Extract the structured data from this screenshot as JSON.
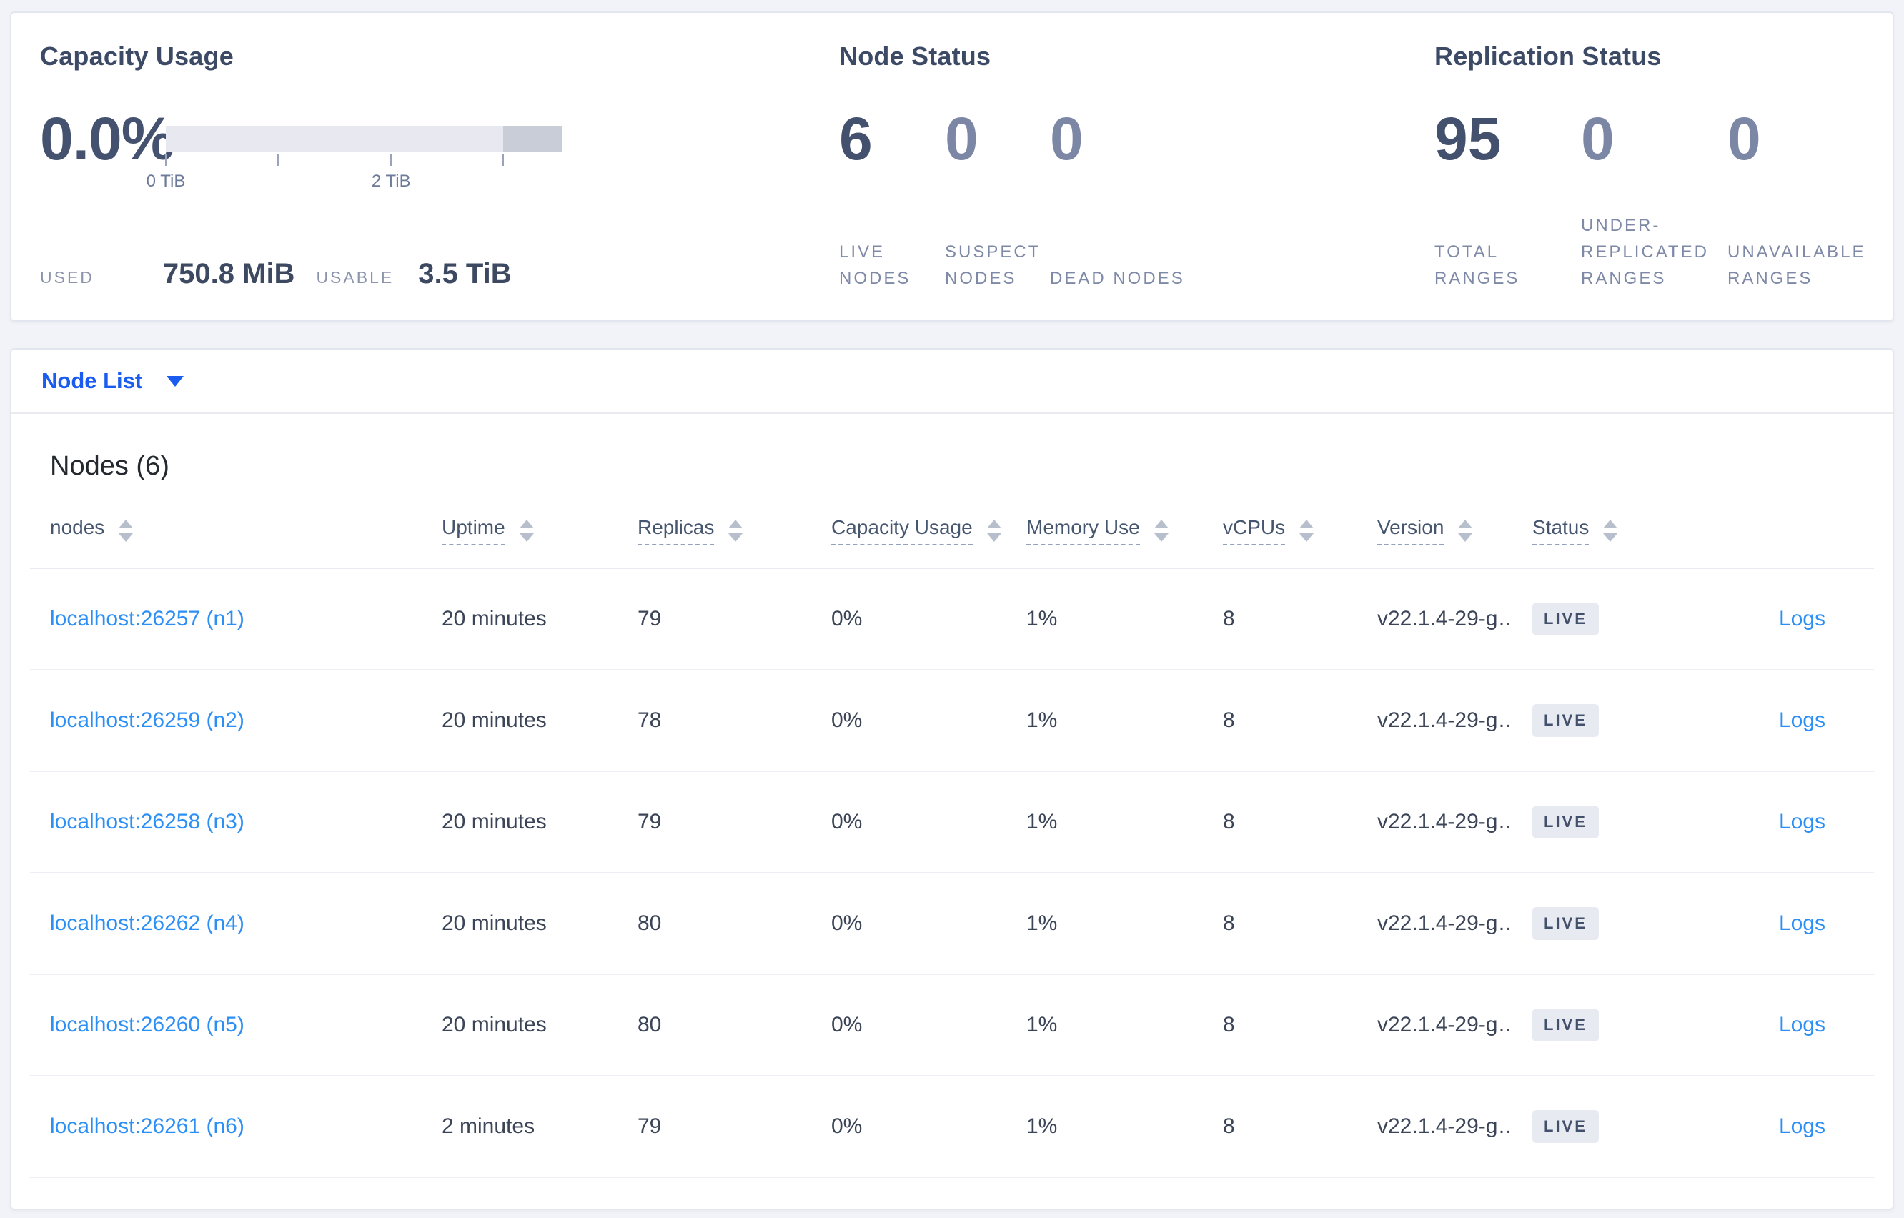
{
  "colors": {
    "page_background": "#f1f3f8",
    "accent_blue": "#1a5cf0",
    "link_blue": "#2b8ff5",
    "dark_slate": "#43516e",
    "muted_label": "#7e89a7",
    "badge_background": "#e7eaf1",
    "bar_light": "#e8e9f0",
    "bar_dark": "#c9cdd8"
  },
  "capacity_usage": {
    "title": "Capacity Usage",
    "percent": "0.0%",
    "used_label": "USED",
    "used_value": "750.8 MiB",
    "usable_label": "USABLE",
    "usable_value": "3.5 TiB",
    "bar": {
      "dark_segment_start_frac": "85.1%",
      "ticks": [
        {
          "left": "0%",
          "label": "0 TiB"
        },
        {
          "left": "28.3%",
          "label": ""
        },
        {
          "left": "56.8%",
          "label": "2 TiB"
        },
        {
          "left": "85.1%",
          "label": ""
        }
      ]
    }
  },
  "node_status": {
    "title": "Node Status",
    "stats": [
      {
        "value": "6",
        "label": "LIVE NODES",
        "primary": true
      },
      {
        "value": "0",
        "label": "SUSPECT NODES"
      },
      {
        "value": "0",
        "label": "DEAD NODES"
      }
    ]
  },
  "replication_status": {
    "title": "Replication Status",
    "stats": [
      {
        "value": "95",
        "label": "TOTAL RANGES",
        "primary": true
      },
      {
        "value": "0",
        "label": "UNDER-REPLICATED RANGES"
      },
      {
        "value": "0",
        "label": "UNAVAILABLE RANGES"
      }
    ]
  },
  "node_list": {
    "dropdown_label": "Node List",
    "section_title": "Nodes (6)",
    "columns": [
      {
        "key": "node",
        "label": "nodes"
      },
      {
        "key": "uptime",
        "label": "Uptime",
        "dashed": true
      },
      {
        "key": "replicas",
        "label": "Replicas",
        "dashed": true
      },
      {
        "key": "capacity",
        "label": "Capacity Usage",
        "dashed": true
      },
      {
        "key": "memory",
        "label": "Memory Use",
        "dashed": true
      },
      {
        "key": "vcpus",
        "label": "vCPUs",
        "dashed": true
      },
      {
        "key": "version",
        "label": "Version",
        "dashed": true
      },
      {
        "key": "status",
        "label": "Status",
        "dashed": true
      },
      {
        "key": "logs",
        "label": "",
        "no_sort": true
      }
    ],
    "rows": [
      {
        "node": "localhost:26257 (n1)",
        "uptime": "20 minutes",
        "replicas": "79",
        "capacity": "0%",
        "memory": "1%",
        "vcpus": "8",
        "version": "v22.1.4-29-g…",
        "status": "LIVE",
        "logs": "Logs"
      },
      {
        "node": "localhost:26259 (n2)",
        "uptime": "20 minutes",
        "replicas": "78",
        "capacity": "0%",
        "memory": "1%",
        "vcpus": "8",
        "version": "v22.1.4-29-g…",
        "status": "LIVE",
        "logs": "Logs"
      },
      {
        "node": "localhost:26258 (n3)",
        "uptime": "20 minutes",
        "replicas": "79",
        "capacity": "0%",
        "memory": "1%",
        "vcpus": "8",
        "version": "v22.1.4-29-g…",
        "status": "LIVE",
        "logs": "Logs"
      },
      {
        "node": "localhost:26262 (n4)",
        "uptime": "20 minutes",
        "replicas": "80",
        "capacity": "0%",
        "memory": "1%",
        "vcpus": "8",
        "version": "v22.1.4-29-g…",
        "status": "LIVE",
        "logs": "Logs"
      },
      {
        "node": "localhost:26260 (n5)",
        "uptime": "20 minutes",
        "replicas": "80",
        "capacity": "0%",
        "memory": "1%",
        "vcpus": "8",
        "version": "v22.1.4-29-g…",
        "status": "LIVE",
        "logs": "Logs"
      },
      {
        "node": "localhost:26261 (n6)",
        "uptime": "2 minutes",
        "replicas": "79",
        "capacity": "0%",
        "memory": "1%",
        "vcpus": "8",
        "version": "v22.1.4-29-g…",
        "status": "LIVE",
        "logs": "Logs"
      }
    ]
  }
}
